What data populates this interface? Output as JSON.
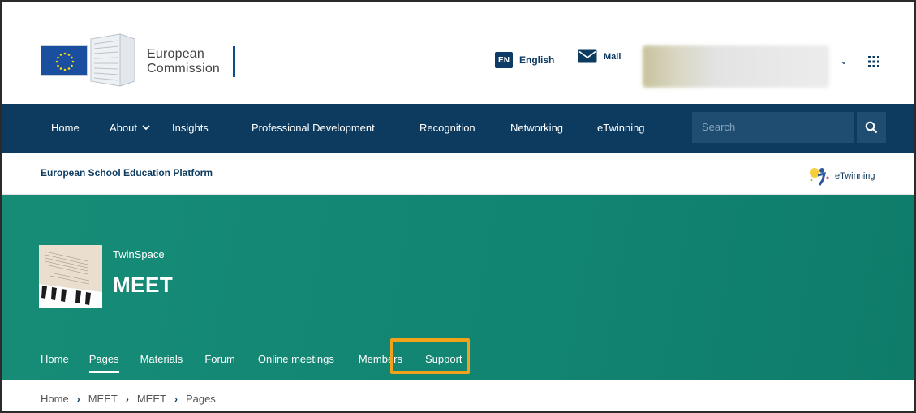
{
  "header": {
    "logo_text_line1": "European",
    "logo_text_line2": "Commission",
    "language_code": "EN",
    "language_label": "English",
    "mail_label": "Mail",
    "user_chevron": "⌄"
  },
  "mainnav": {
    "items": [
      {
        "label": "Home"
      },
      {
        "label": "About"
      },
      {
        "label": "Insights"
      },
      {
        "label": "Professional Development"
      },
      {
        "label": "Recognition"
      },
      {
        "label": "Networking"
      },
      {
        "label": "eTwinning"
      }
    ],
    "search_placeholder": "Search"
  },
  "platform": {
    "title": "European School Education Platform",
    "etwinning_label": "eTwinning"
  },
  "banner": {
    "subtitle": "TwinSpace",
    "title": "MEET"
  },
  "subnav": {
    "items": [
      {
        "label": "Home"
      },
      {
        "label": "Pages"
      },
      {
        "label": "Materials"
      },
      {
        "label": "Forum"
      },
      {
        "label": "Online meetings"
      },
      {
        "label": "Members"
      },
      {
        "label": "Support"
      }
    ],
    "active": "Pages",
    "highlighted": "Members",
    "highlight_color": "#f0a21a"
  },
  "breadcrumb": {
    "items": [
      "Home",
      "MEET",
      "MEET",
      "Pages"
    ],
    "separator": "›"
  },
  "colors": {
    "nav_bg": "#0d3b5f",
    "banner_bg": "#128472",
    "accent": "#f0a21a"
  }
}
